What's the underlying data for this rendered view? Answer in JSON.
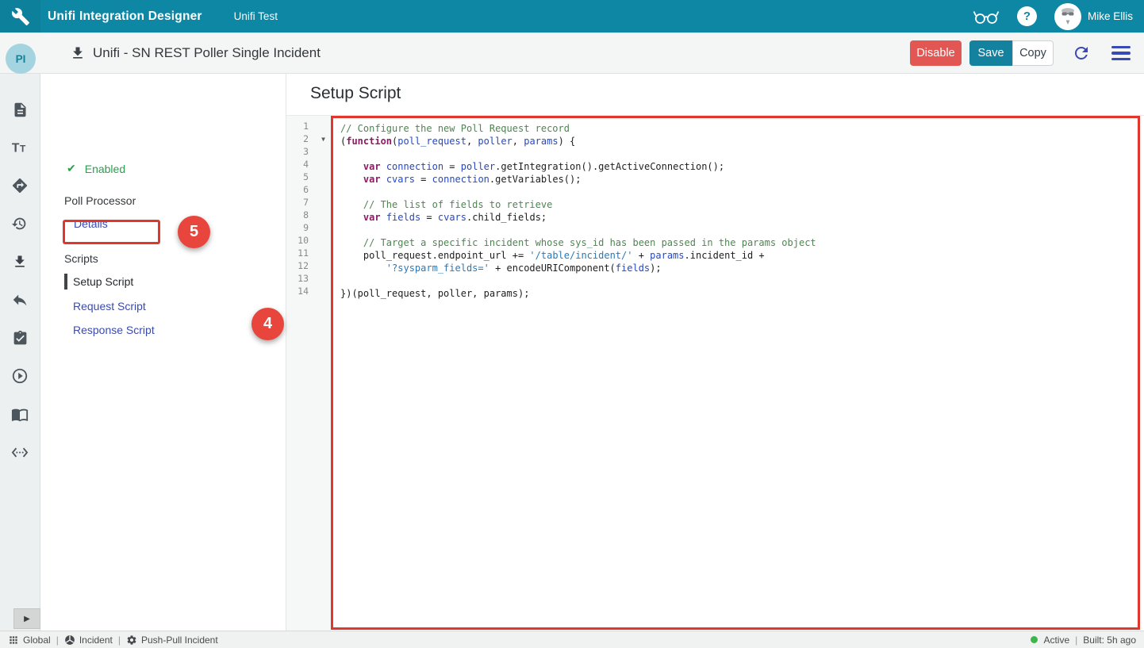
{
  "header": {
    "app_title": "Unifi Integration Designer",
    "environment": "Unifi Test",
    "user_name": "Mike Ellis",
    "help_glyph": "?",
    "icons": [
      "wrench-icon",
      "glasses-icon",
      "help-icon",
      "user-avatar"
    ]
  },
  "toolbar": {
    "record_title": "Unifi - SN REST Poller Single Incident",
    "avatar_initials": "PI",
    "disable_label": "Disable",
    "save_label": "Save",
    "copy_label": "Copy",
    "icons": [
      "download-icon",
      "refresh-icon",
      "hamburger-menu-icon"
    ]
  },
  "iconbar": {
    "items": [
      "document-icon",
      "text-format-icon",
      "integration-icon",
      "history-icon",
      "download-icon",
      "reply-icon",
      "tasks-icon",
      "run-icon",
      "documentation-icon",
      "code-icon"
    ],
    "collapse_glyph": "▶"
  },
  "nav": {
    "enabled_label": "Enabled",
    "poll_processor_label": "Poll Processor",
    "details_label": "Details",
    "scripts_label": "Scripts",
    "setup_script_label": "Setup Script",
    "request_script_label": "Request Script",
    "response_script_label": "Response Script"
  },
  "editor": {
    "title": "Setup Script",
    "fold_line": 2,
    "lines": [
      {
        "n": 1,
        "t": [
          [
            "c",
            "// Configure the new Poll Request record"
          ]
        ]
      },
      {
        "n": 2,
        "t": [
          [
            "p",
            "("
          ],
          [
            "k",
            "function"
          ],
          [
            "p",
            "("
          ],
          [
            "v",
            "poll_request"
          ],
          [
            "p",
            ", "
          ],
          [
            "v",
            "poller"
          ],
          [
            "p",
            ", "
          ],
          [
            "v",
            "params"
          ],
          [
            "p",
            ") {"
          ]
        ]
      },
      {
        "n": 3,
        "t": []
      },
      {
        "n": 4,
        "t": [
          [
            "p",
            "    "
          ],
          [
            "k",
            "var"
          ],
          [
            "p",
            " "
          ],
          [
            "v",
            "connection"
          ],
          [
            "p",
            " = "
          ],
          [
            "v",
            "poller"
          ],
          [
            "p",
            ".getIntegration().getActiveConnection();"
          ]
        ]
      },
      {
        "n": 5,
        "t": [
          [
            "p",
            "    "
          ],
          [
            "k",
            "var"
          ],
          [
            "p",
            " "
          ],
          [
            "v",
            "cvars"
          ],
          [
            "p",
            " = "
          ],
          [
            "v",
            "connection"
          ],
          [
            "p",
            ".getVariables();"
          ]
        ]
      },
      {
        "n": 6,
        "t": []
      },
      {
        "n": 7,
        "t": [
          [
            "p",
            "    "
          ],
          [
            "c",
            "// The list of fields to retrieve"
          ]
        ]
      },
      {
        "n": 8,
        "t": [
          [
            "p",
            "    "
          ],
          [
            "k",
            "var"
          ],
          [
            "p",
            " "
          ],
          [
            "v",
            "fields"
          ],
          [
            "p",
            " = "
          ],
          [
            "v",
            "cvars"
          ],
          [
            "p",
            ".child_fields;"
          ]
        ]
      },
      {
        "n": 9,
        "t": []
      },
      {
        "n": 10,
        "t": [
          [
            "p",
            "    "
          ],
          [
            "c",
            "// Target a specific incident whose sys_id has been passed in the params object"
          ]
        ]
      },
      {
        "n": 11,
        "t": [
          [
            "p",
            "    poll_request.endpoint_url += "
          ],
          [
            "s",
            "'/table/incident/'"
          ],
          [
            "p",
            " + "
          ],
          [
            "v",
            "params"
          ],
          [
            "p",
            ".incident_id +"
          ]
        ]
      },
      {
        "n": 12,
        "t": [
          [
            "p",
            "        "
          ],
          [
            "s",
            "'?sysparm_fields='"
          ],
          [
            "p",
            " + encodeURIComponent("
          ],
          [
            "v",
            "fields"
          ],
          [
            "p",
            ");"
          ]
        ]
      },
      {
        "n": 13,
        "t": []
      },
      {
        "n": 14,
        "t": [
          [
            "p",
            "})(poll_request, poller, params);"
          ]
        ]
      }
    ]
  },
  "annotations": {
    "badge_4": "4",
    "badge_5": "5",
    "box_color": "#e0372c"
  },
  "statusbar": {
    "left": [
      {
        "icon": "grid-icon",
        "label": "Global"
      },
      {
        "icon": "incident-icon",
        "label": "Incident"
      },
      {
        "icon": "gear-icon",
        "label": "Push-Pull Incident"
      }
    ],
    "separator": "|",
    "active_label": "Active",
    "built_label": "Built: 5h ago"
  },
  "colors": {
    "header_teal": "#0e87a5",
    "accent_indigo": "#3a4ab0",
    "danger_red": "#e25654",
    "annotation_red": "#e0372c",
    "enabled_green": "#2d9e4f",
    "active_green": "#3cb54a"
  }
}
